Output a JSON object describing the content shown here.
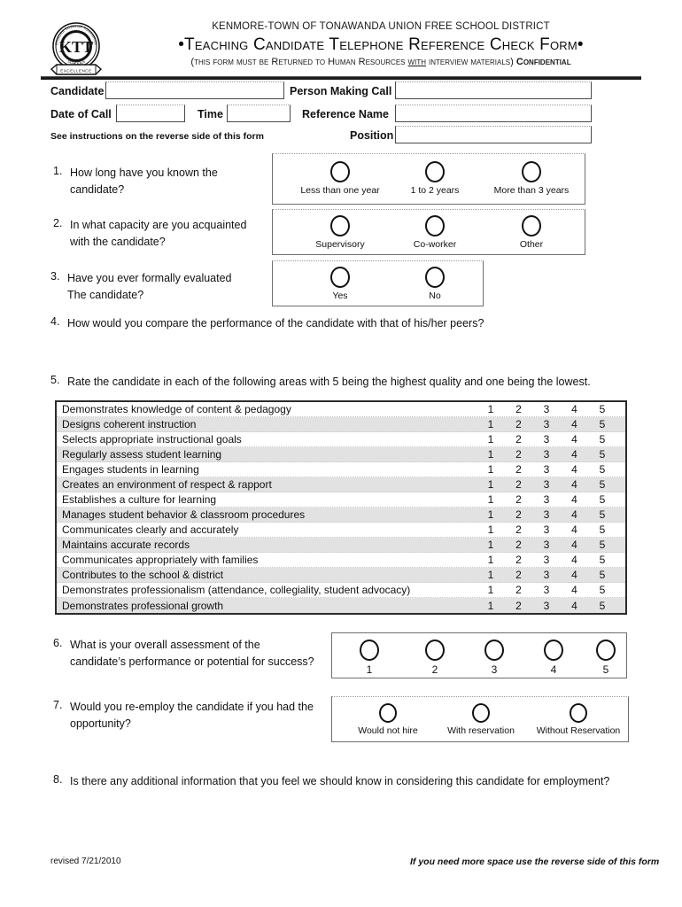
{
  "header": {
    "district": "KENMORE-TOWN OF TONAWANDA UNION FREE SCHOOL DISTRICT",
    "title": "•Teaching Candidate Telephone Reference Check Form•",
    "subtitle_part1": "(this form must be Returned to Human Resources ",
    "subtitle_underlined": "with",
    "subtitle_part2": " interview materials) ",
    "subtitle_bold": "Confidential",
    "logo_alt": "school-district-seal"
  },
  "fields": {
    "candidate_label": "Candidate",
    "candidate_value": "",
    "person_making_call_label": "Person Making Call",
    "person_making_call_value": "",
    "date_of_call_label": "Date of Call",
    "date_of_call_value": "",
    "time_label": "Time",
    "time_value": "",
    "reference_name_label": "Reference Name",
    "reference_name_value": "",
    "position_label": "Position",
    "position_value": "",
    "instructions_note": "See instructions on the reverse side of this form"
  },
  "questions": {
    "q1": {
      "number": "1.",
      "text_line1": "How long have you known the",
      "text_line2": "candidate?",
      "options": [
        "Less than one year",
        "1 to 2 years",
        "More than 3 years"
      ]
    },
    "q2": {
      "number": "2.",
      "text_line1": "In what capacity are you acquainted",
      "text_line2": "with the candidate?",
      "options": [
        "Supervisory",
        "Co-worker",
        "Other"
      ]
    },
    "q3": {
      "number": "3.",
      "text_line1": "Have you ever formally evaluated",
      "text_line2": "The candidate?",
      "options": [
        "Yes",
        "No"
      ]
    },
    "q4": {
      "number": "4.",
      "text": "How would you compare the performance of the candidate with that of his/her peers?"
    },
    "q5": {
      "number": "5.",
      "text": "Rate the candidate in each of the following areas with 5 being the highest quality and one being the lowest."
    },
    "q6": {
      "number": "6.",
      "text_line1": "What is your overall assessment of the",
      "text_line2": "candidate’s  performance or potential for success?",
      "options": [
        "1",
        "2",
        "3",
        "4",
        "5"
      ]
    },
    "q7": {
      "number": "7.",
      "text_line1": "Would you re-employ the candidate if you had the",
      "text_line2": "opportunity?",
      "options": [
        "Would not hire",
        "With reservation",
        "Without Reservation"
      ]
    },
    "q8": {
      "number": "8.",
      "text": "Is there any additional information that you feel we should know in considering this candidate for employment?"
    }
  },
  "rating_table": {
    "scale": [
      "1",
      "2",
      "3",
      "4",
      "5"
    ],
    "rows": [
      {
        "label": "Demonstrates knowledge of content & pedagogy",
        "shaded": false
      },
      {
        "label": "Designs coherent instruction",
        "shaded": true
      },
      {
        "label": "Selects appropriate instructional goals",
        "shaded": false
      },
      {
        "label": "Regularly assess student learning",
        "shaded": true
      },
      {
        "label": "Engages students in learning",
        "shaded": false
      },
      {
        "label": "Creates an environment of respect & rapport",
        "shaded": true
      },
      {
        "label": "Establishes a culture for learning",
        "shaded": false
      },
      {
        "label": "Manages student behavior & classroom procedures",
        "shaded": true
      },
      {
        "label": "Communicates clearly and accurately",
        "shaded": false
      },
      {
        "label": "Maintains accurate records",
        "shaded": true
      },
      {
        "label": "Communicates appropriately with families",
        "shaded": false
      },
      {
        "label": "Contributes to the school & district",
        "shaded": true
      },
      {
        "label": "Demonstrates professionalism (attendance, collegiality, student advocacy)",
        "shaded": false
      },
      {
        "label": "Demonstrates professional growth",
        "shaded": true
      }
    ]
  },
  "footer": {
    "revised": "revised 7/21/2010",
    "note": "If you need more space use the reverse side of this form"
  },
  "colors": {
    "ink": "#111111",
    "rule": "#1a1a1a",
    "shade": "#e2e2e2",
    "box_border": "#6e6e6e"
  }
}
